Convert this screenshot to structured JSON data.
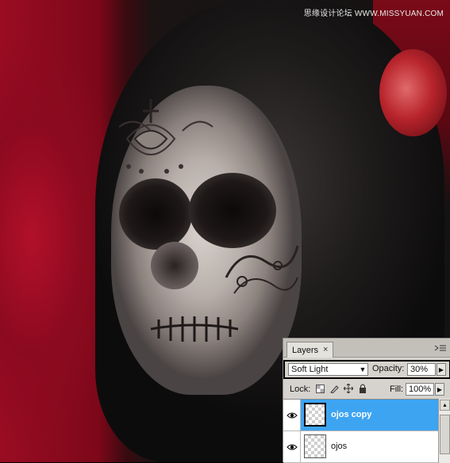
{
  "watermark": "思缘设计论坛 WWW.MISSYUAN.COM",
  "layers_panel": {
    "tab_label": "Layers",
    "tab_close": "×",
    "blend_mode": "Soft Light",
    "opacity_label": "Opacity:",
    "opacity_value": "30%",
    "lock_label": "Lock:",
    "fill_label": "Fill:",
    "fill_value": "100%",
    "layers": [
      {
        "name": "ojos copy",
        "selected": true
      },
      {
        "name": "ojos",
        "selected": false
      }
    ]
  },
  "icons": {
    "visibility": "eye-icon",
    "menu": "panel-menu-icon",
    "lock_transparent": "lock-transparent-pixels-icon",
    "lock_image": "lock-image-pixels-icon",
    "lock_position": "lock-position-icon",
    "lock_all": "lock-all-icon"
  },
  "colors": {
    "selected_layer": "#3da4f2",
    "panel_bg": "#d6d3ce",
    "background_red": "#9a0c22"
  }
}
